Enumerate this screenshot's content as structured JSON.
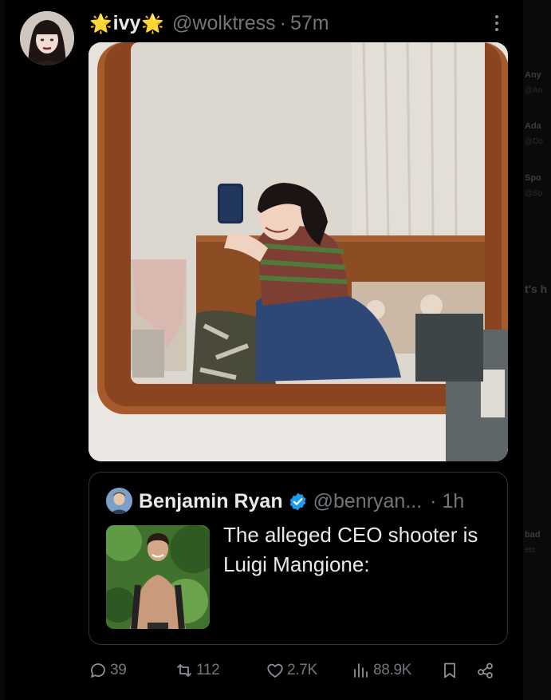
{
  "tweet": {
    "display_name": "ivy",
    "name_decoration": "🌟",
    "handle": "@wolktress",
    "separator": "·",
    "time": "57m",
    "more_icon": "more-dots-icon",
    "media_description": "mirror-selfie-photo"
  },
  "quote": {
    "name": "Benjamin Ryan",
    "verified_icon": "verified-badge-icon",
    "handle": "@benryan...",
    "time": "· 1h",
    "text": "The alleged CEO shooter is Luigi Mangione:"
  },
  "actions": {
    "replies": "39",
    "reposts": "112",
    "likes": "2.7K",
    "views": "88.9K"
  },
  "side_column": [
    {
      "title": "Any",
      "sub": "@An"
    },
    {
      "title": "Ada",
      "sub": "@Do"
    },
    {
      "title": "Spo",
      "sub": "@Sp"
    },
    {
      "title": "t's h",
      "sub": ""
    },
    {
      "title": "bad",
      "sub": "ets"
    }
  ],
  "colors": {
    "background": "#000000",
    "text_primary": "#e7e9ea",
    "text_secondary": "#71767b",
    "border": "#2f3336",
    "verified": "#1d9bf0"
  }
}
